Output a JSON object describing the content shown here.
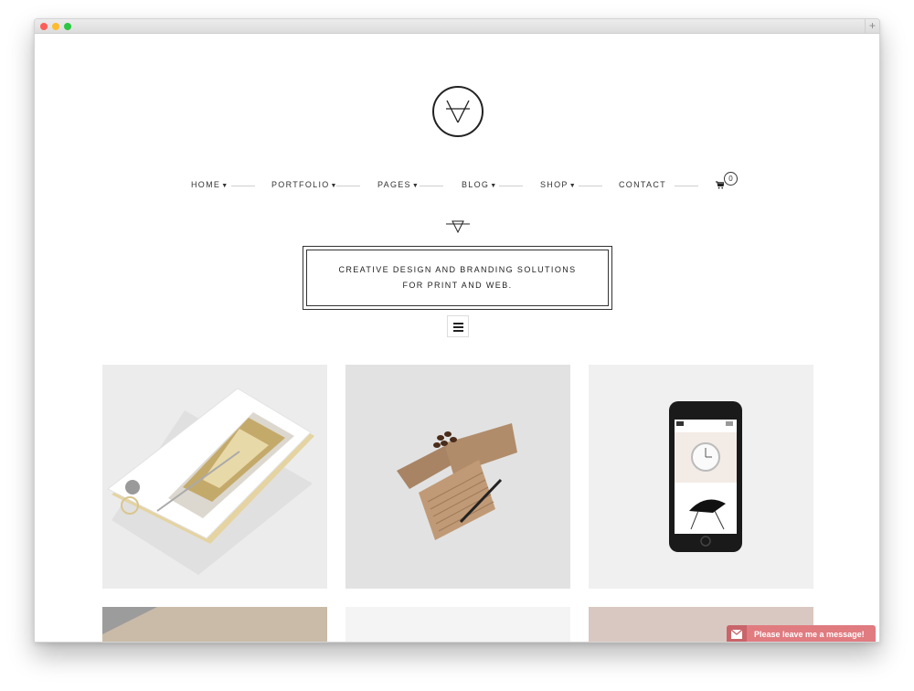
{
  "browser": {
    "new_tab_icon": "plus-icon"
  },
  "site": {
    "logo_icon": "v-monogram-logo",
    "nav": [
      {
        "label": "HOME",
        "has_dropdown": true
      },
      {
        "label": "PORTFOLIO",
        "has_dropdown": true
      },
      {
        "label": "PAGES",
        "has_dropdown": true
      },
      {
        "label": "BLOG",
        "has_dropdown": true
      },
      {
        "label": "SHOP",
        "has_dropdown": true
      },
      {
        "label": "CONTACT",
        "has_dropdown": false
      }
    ],
    "cart": {
      "icon": "cart-icon",
      "count": "0"
    },
    "tagline": {
      "line1": "CREATIVE DESIGN AND BRANDING SOLUTIONS",
      "line2": "FOR PRINT AND WEB."
    },
    "menu_toggle_icon": "hamburger-icon",
    "portfolio": [
      {
        "subject": "phone-mockup-champagne"
      },
      {
        "subject": "kraft-stationery-mockup"
      },
      {
        "subject": "smartphone-watch-chair"
      },
      {
        "subject": "fabric-texture"
      },
      {
        "subject": "light-gray"
      },
      {
        "subject": "pink-surface"
      }
    ]
  },
  "chat_widget": {
    "icon": "envelope-icon",
    "label": "Please leave me a message!",
    "color": "#e07b80"
  },
  "colors": {
    "text": "#333333",
    "border": "#222222",
    "tile_bg": "#eeeeee"
  }
}
